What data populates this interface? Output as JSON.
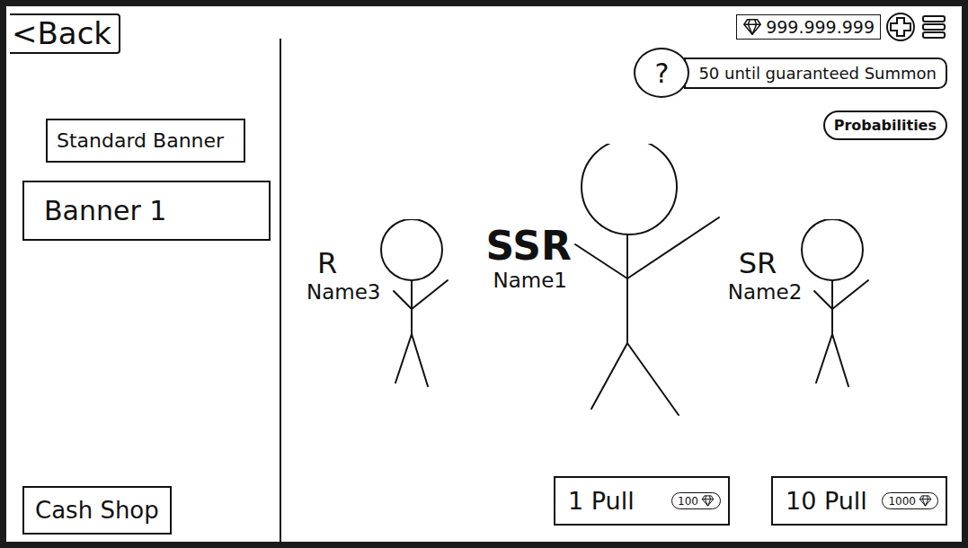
{
  "back_button": "<Back",
  "currency": {
    "amount": "999.999.999"
  },
  "sidebar": {
    "items": [
      {
        "label": "Standard Banner",
        "selected": false
      },
      {
        "label": "Banner 1",
        "selected": true
      }
    ],
    "shop": "Cash Shop"
  },
  "pity": {
    "help": "?",
    "text": "50 until guaranteed Summon"
  },
  "probabilities": "Probabilities",
  "characters": [
    {
      "rarity": "R",
      "name": "Name3",
      "kind": "normal"
    },
    {
      "rarity": "SSR",
      "name": "Name1",
      "kind": "featured"
    },
    {
      "rarity": "SR",
      "name": "Name2",
      "kind": "normal"
    }
  ],
  "pulls": [
    {
      "label": "1 Pull",
      "cost": "100"
    },
    {
      "label": "10 Pull",
      "cost": "1000"
    }
  ]
}
